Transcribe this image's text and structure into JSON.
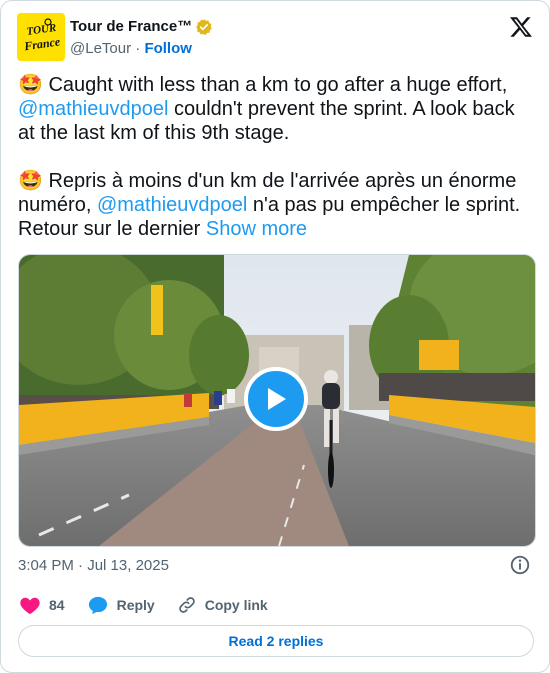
{
  "author": {
    "display_name": "Tour de France™",
    "handle": "@LeTour",
    "separator": "·",
    "follow_label": "Follow",
    "avatar_text_line1": "TOUR",
    "avatar_text_line2": "France",
    "avatar_bg": "#ffe100",
    "verified_badge": "gold-verified-icon"
  },
  "tweet": {
    "para1_emoji": "🤩",
    "para1_text_a": " Caught with less than a km to go after a huge effort, ",
    "para1_mention": "@mathieuvdpoel",
    "para1_text_b": " couldn't prevent the sprint. A look back at the last km of this 9th stage.",
    "para2_emoji": "🤩",
    "para2_text_a": " Repris à moins d'un km de l'arrivée après un énorme numéro, ",
    "para2_mention": "@mathieuvdpoel",
    "para2_text_b": " n'a pas pu empêcher le sprint. Retour sur le dernier ",
    "show_more": "Show more"
  },
  "media": {
    "type": "video",
    "play_icon": "play-icon"
  },
  "meta": {
    "time": "3:04 PM",
    "separator": "·",
    "date": "Jul 13, 2025"
  },
  "actions": {
    "likes": "84",
    "reply_label": "Reply",
    "copy_link_label": "Copy link"
  },
  "replies_button": "Read 2 replies",
  "colors": {
    "link": "#1d9bf0",
    "follow": "#006fd6",
    "like": "#f91880",
    "reply_bubble": "#1d9bf0"
  }
}
